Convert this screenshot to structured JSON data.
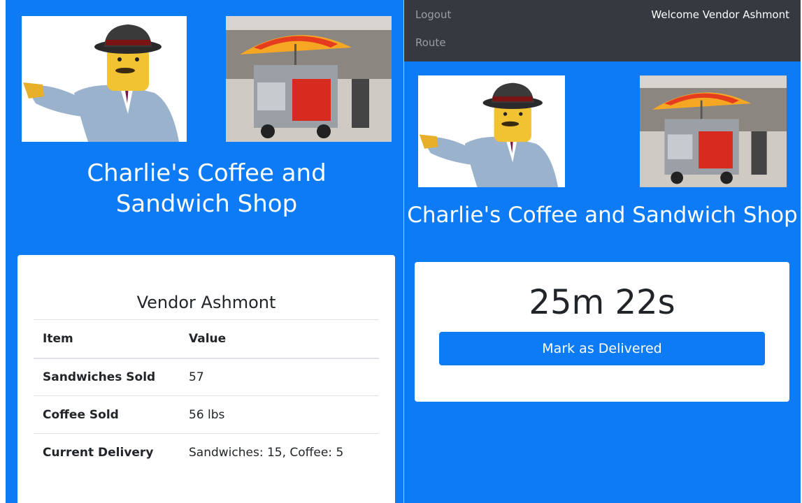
{
  "left": {
    "shop_title": "Charlie's Coffee and Sandwich Shop",
    "vendor_name": "Vendor Ashmont",
    "table": {
      "headers": [
        "Item",
        "Value"
      ],
      "rows": [
        {
          "item": "Sandwiches Sold",
          "value": "57"
        },
        {
          "item": "Coffee Sold",
          "value": "56 lbs"
        },
        {
          "item": "Current Delivery",
          "value": "Sandwiches: 15, Coffee: 5"
        }
      ]
    }
  },
  "right": {
    "nav": {
      "logout": "Logout",
      "route": "Route",
      "welcome": "Welcome Vendor Ashmont"
    },
    "shop_title": "Charlie's Coffee and Sandwich Shop",
    "timer": "25m 22s",
    "deliver_button": "Mark as Delivered"
  },
  "colors": {
    "primary": "#0d7bf6",
    "navbar": "#343a40",
    "nav_link": "#9a9da0"
  },
  "icons": [
    "mascot-logo",
    "hot-dog-cart-photo"
  ]
}
